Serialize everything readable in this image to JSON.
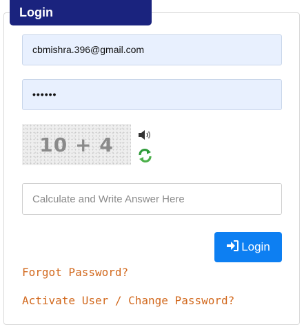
{
  "login_form": {
    "title": "Login",
    "email_value": "cbmishra.396@gmail.com",
    "password_value": "••••••",
    "captcha_text": "10 + 4",
    "answer_placeholder": "Calculate and Write Answer Here",
    "login_button_label": "Login",
    "forgot_password_link": "Forgot Password?",
    "activate_link": "Activate User / Change Password?"
  },
  "icons": {
    "audio": "speaker-icon",
    "refresh": "refresh-icon",
    "login": "sign-in-icon"
  },
  "colors": {
    "title_bg": "#1a237e",
    "button_bg": "#0d7ff2",
    "link": "#d2691e",
    "autofill_bg": "#e8f0fe"
  }
}
